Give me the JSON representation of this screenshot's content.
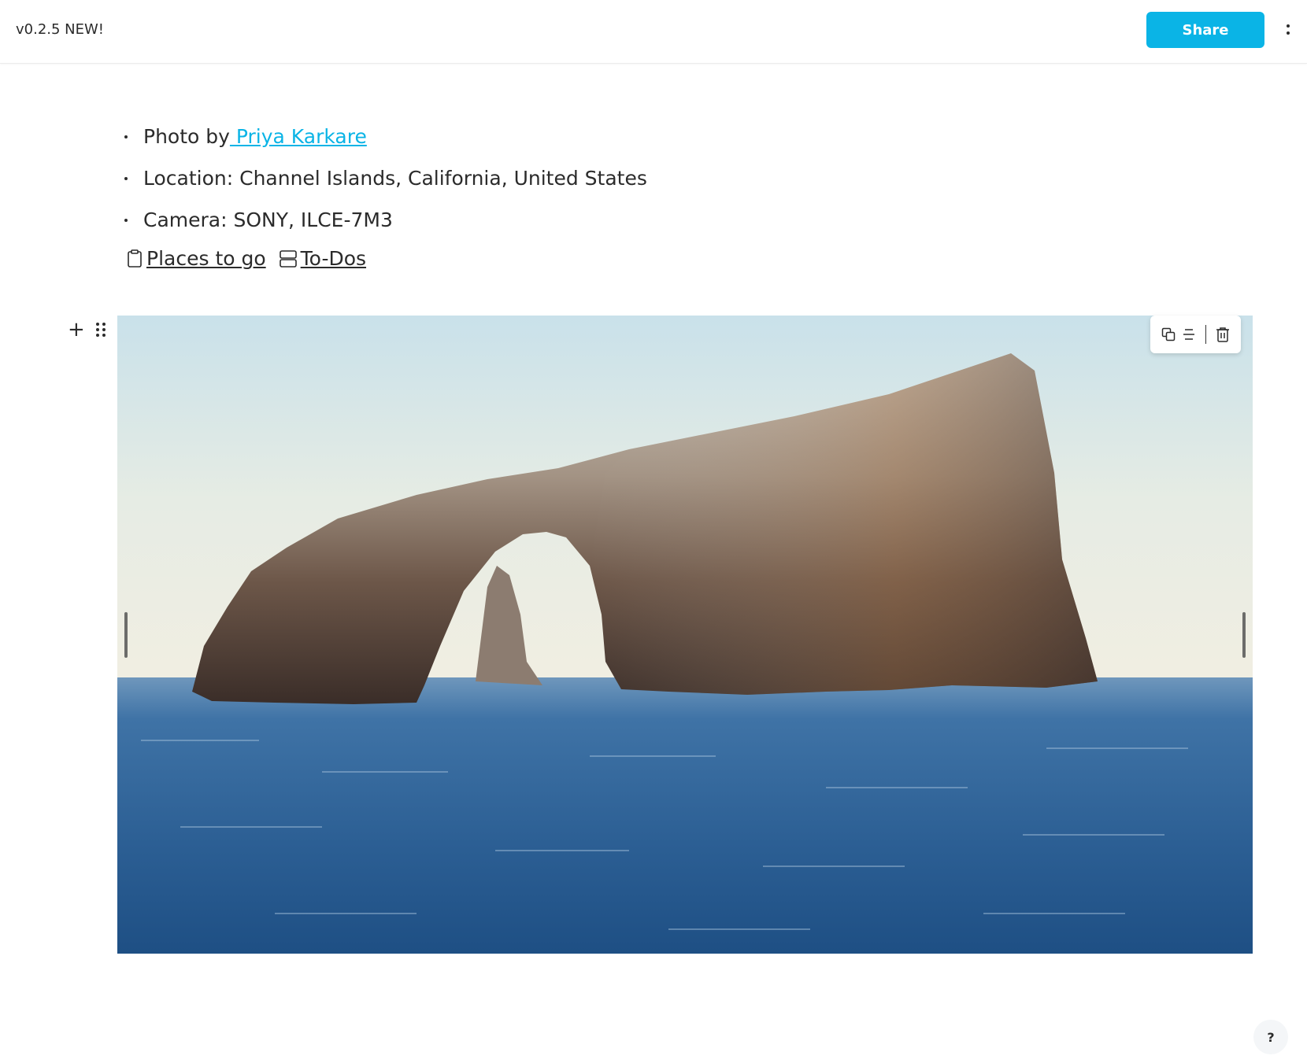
{
  "header": {
    "version_label": "v0.2.5 NEW!",
    "share_label": "Share",
    "more_icon": "more-vertical-icon",
    "accent_color": "#0ab4e6"
  },
  "photo_info": {
    "photo_by_prefix": "Photo by",
    "author_name": " Priya Karkare",
    "location": "Location: Channel Islands, California, United States",
    "camera": "Camera: SONY, ILCE-7M3"
  },
  "page_links": [
    {
      "icon": "clipboard-icon",
      "label": "Places to go"
    },
    {
      "icon": "database-icon",
      "label": "To-Dos"
    }
  ],
  "block_controls": {
    "add_icon": "plus-icon",
    "drag_icon": "drag-handle-icon"
  },
  "image_toolbar": {
    "icons": [
      "duplicate-icon",
      "align-icon",
      "trash-icon"
    ]
  },
  "help": {
    "label": "?"
  }
}
